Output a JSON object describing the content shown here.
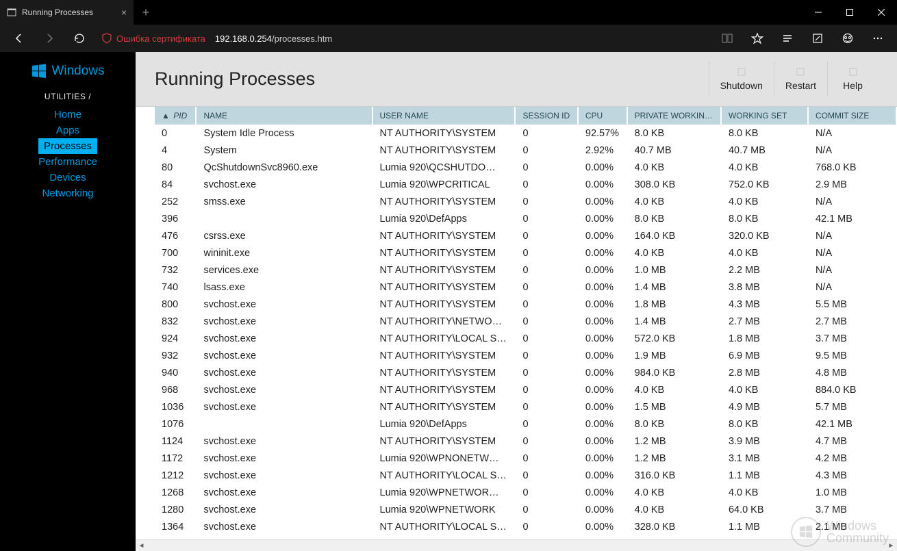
{
  "browser": {
    "tab_title": "Running Processes",
    "cert_warning": "Ошибка сертификата",
    "url_host": "192.168.0.254",
    "url_path": "/processes.htm"
  },
  "sidebar": {
    "logo_text": "Windows",
    "header": "UTILITIES /",
    "items": [
      "Home",
      "Apps",
      "Processes",
      "Performance",
      "Devices",
      "Networking"
    ],
    "active_index": 2
  },
  "page": {
    "title": "Running Processes",
    "actions": [
      "Shutdown",
      "Restart",
      "Help"
    ]
  },
  "table": {
    "columns": [
      "PID",
      "NAME",
      "USER NAME",
      "SESSION ID",
      "CPU",
      "PRIVATE WORKIN…",
      "WORKING SET",
      "COMMIT SIZE"
    ],
    "sorted_col": 0,
    "rows": [
      [
        "0",
        "System Idle Process",
        "NT AUTHORITY\\SYSTEM",
        "0",
        "92.57%",
        "8.0 KB",
        "8.0 KB",
        "N/A"
      ],
      [
        "4",
        "System",
        "NT AUTHORITY\\SYSTEM",
        "0",
        "2.92%",
        "40.7 MB",
        "40.7 MB",
        "N/A"
      ],
      [
        "80",
        "QcShutdownSvc8960.exe",
        "Lumia 920\\QCSHUTDO…",
        "0",
        "0.00%",
        "4.0 KB",
        "4.0 KB",
        "768.0 KB"
      ],
      [
        "84",
        "svchost.exe",
        "Lumia 920\\WPCRITICAL",
        "0",
        "0.00%",
        "308.0 KB",
        "752.0 KB",
        "2.9 MB"
      ],
      [
        "252",
        "smss.exe",
        "NT AUTHORITY\\SYSTEM",
        "0",
        "0.00%",
        "4.0 KB",
        "4.0 KB",
        "N/A"
      ],
      [
        "396",
        "",
        "Lumia 920\\DefApps",
        "0",
        "0.00%",
        "8.0 KB",
        "8.0 KB",
        "42.1 MB"
      ],
      [
        "476",
        "csrss.exe",
        "NT AUTHORITY\\SYSTEM",
        "0",
        "0.00%",
        "164.0 KB",
        "320.0 KB",
        "N/A"
      ],
      [
        "700",
        "wininit.exe",
        "NT AUTHORITY\\SYSTEM",
        "0",
        "0.00%",
        "4.0 KB",
        "4.0 KB",
        "N/A"
      ],
      [
        "732",
        "services.exe",
        "NT AUTHORITY\\SYSTEM",
        "0",
        "0.00%",
        "1.0 MB",
        "2.2 MB",
        "N/A"
      ],
      [
        "740",
        "lsass.exe",
        "NT AUTHORITY\\SYSTEM",
        "0",
        "0.00%",
        "1.4 MB",
        "3.8 MB",
        "N/A"
      ],
      [
        "800",
        "svchost.exe",
        "NT AUTHORITY\\SYSTEM",
        "0",
        "0.00%",
        "1.8 MB",
        "4.3 MB",
        "5.5 MB"
      ],
      [
        "832",
        "svchost.exe",
        "NT AUTHORITY\\NETWO…",
        "0",
        "0.00%",
        "1.4 MB",
        "2.7 MB",
        "2.7 MB"
      ],
      [
        "924",
        "svchost.exe",
        "NT AUTHORITY\\LOCAL S…",
        "0",
        "0.00%",
        "572.0 KB",
        "1.8 MB",
        "3.7 MB"
      ],
      [
        "932",
        "svchost.exe",
        "NT AUTHORITY\\SYSTEM",
        "0",
        "0.00%",
        "1.9 MB",
        "6.9 MB",
        "9.5 MB"
      ],
      [
        "940",
        "svchost.exe",
        "NT AUTHORITY\\SYSTEM",
        "0",
        "0.00%",
        "984.0 KB",
        "2.8 MB",
        "4.8 MB"
      ],
      [
        "968",
        "svchost.exe",
        "NT AUTHORITY\\SYSTEM",
        "0",
        "0.00%",
        "4.0 KB",
        "4.0 KB",
        "884.0 KB"
      ],
      [
        "1036",
        "svchost.exe",
        "NT AUTHORITY\\SYSTEM",
        "0",
        "0.00%",
        "1.5 MB",
        "4.9 MB",
        "5.7 MB"
      ],
      [
        "1076",
        "",
        "Lumia 920\\DefApps",
        "0",
        "0.00%",
        "8.0 KB",
        "8.0 KB",
        "42.1 MB"
      ],
      [
        "1124",
        "svchost.exe",
        "NT AUTHORITY\\SYSTEM",
        "0",
        "0.00%",
        "1.2 MB",
        "3.9 MB",
        "4.7 MB"
      ],
      [
        "1172",
        "svchost.exe",
        "Lumia 920\\WPNONETW…",
        "0",
        "0.00%",
        "1.2 MB",
        "3.1 MB",
        "4.2 MB"
      ],
      [
        "1212",
        "svchost.exe",
        "NT AUTHORITY\\LOCAL S…",
        "0",
        "0.00%",
        "316.0 KB",
        "1.1 MB",
        "4.3 MB"
      ],
      [
        "1268",
        "svchost.exe",
        "Lumia 920\\WPNETWOR…",
        "0",
        "0.00%",
        "4.0 KB",
        "4.0 KB",
        "1.0 MB"
      ],
      [
        "1280",
        "svchost.exe",
        "Lumia 920\\WPNETWORK",
        "0",
        "0.00%",
        "4.0 KB",
        "64.0 KB",
        "3.7 MB"
      ],
      [
        "1364",
        "svchost.exe",
        "NT AUTHORITY\\LOCAL S…",
        "0",
        "0.00%",
        "328.0 KB",
        "1.1 MB",
        "2.1 MB"
      ]
    ]
  },
  "watermark": {
    "text1": "Windows",
    "text2": "Community"
  }
}
